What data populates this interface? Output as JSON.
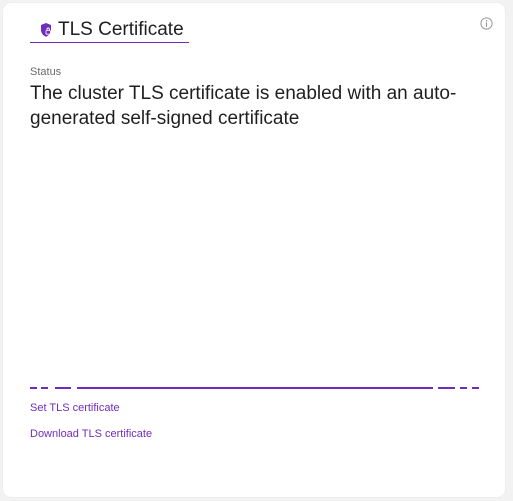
{
  "card": {
    "title": "TLS Certificate",
    "title_icon": "shield-lock-icon",
    "info_icon": "info-icon",
    "status_label": "Status",
    "status_text": "The cluster TLS certificate is enabled with an auto-generated self-signed certificate"
  },
  "actions": {
    "set_label": "Set TLS certificate",
    "download_label": "Download TLS certificate"
  },
  "colors": {
    "accent": "#6f2dbd",
    "text": "#1f1f1f",
    "muted": "#6b6b6b",
    "info_icon": "#9a9a9a"
  }
}
